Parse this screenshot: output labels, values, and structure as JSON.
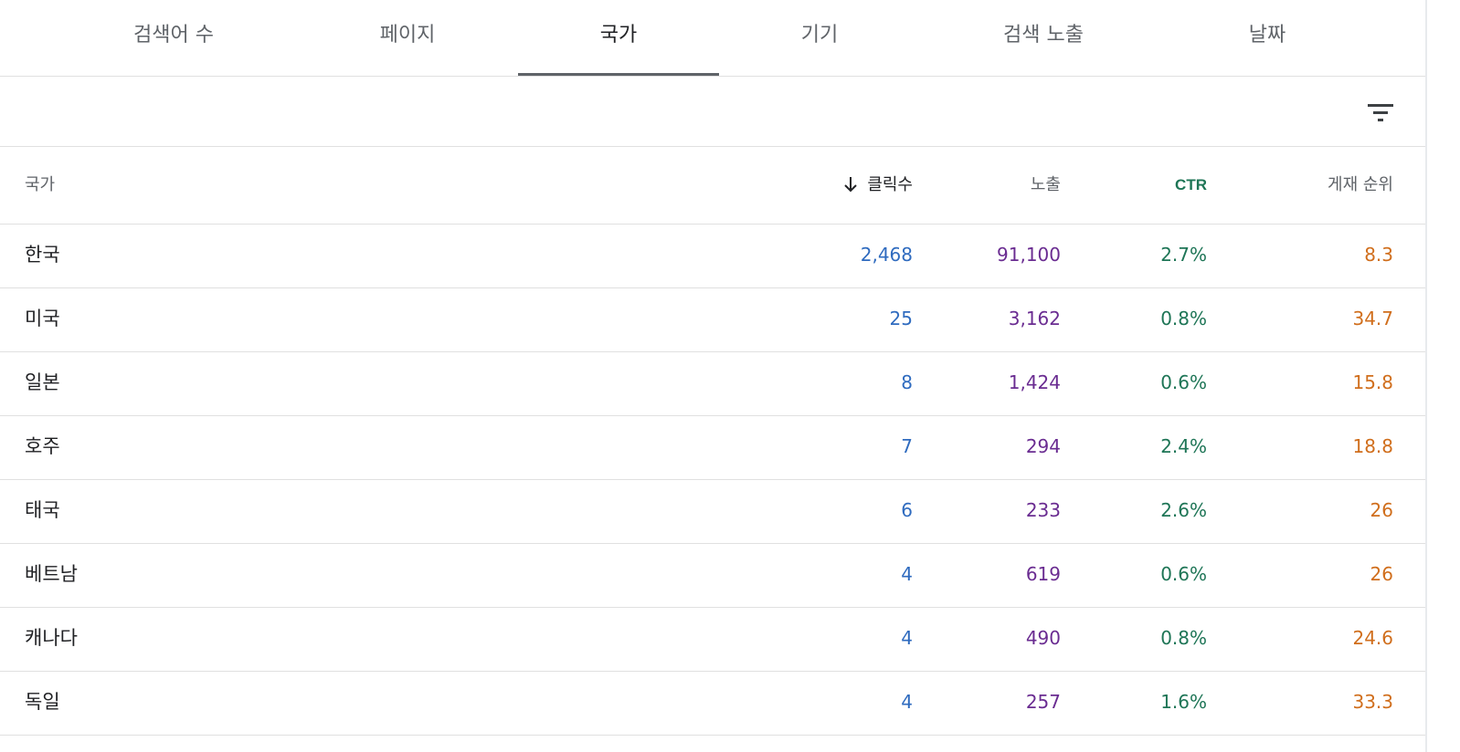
{
  "tabs": [
    {
      "label": "검색어 수",
      "active": false
    },
    {
      "label": "페이지",
      "active": false
    },
    {
      "label": "국가",
      "active": true
    },
    {
      "label": "기기",
      "active": false
    },
    {
      "label": "검색 노출",
      "active": false
    },
    {
      "label": "날짜",
      "active": false
    }
  ],
  "toolbar": {
    "filter_icon": "filter-list-icon"
  },
  "table": {
    "headers": {
      "country": "국가",
      "clicks": "클릭수",
      "impressions": "노출",
      "ctr": "CTR",
      "position": "게재 순위"
    },
    "sorted_by": "clicks",
    "sort_direction": "desc",
    "rows": [
      {
        "country": "한국",
        "clicks": "2,468",
        "impressions": "91,100",
        "ctr": "2.7%",
        "position": "8.3"
      },
      {
        "country": "미국",
        "clicks": "25",
        "impressions": "3,162",
        "ctr": "0.8%",
        "position": "34.7"
      },
      {
        "country": "일본",
        "clicks": "8",
        "impressions": "1,424",
        "ctr": "0.6%",
        "position": "15.8"
      },
      {
        "country": "호주",
        "clicks": "7",
        "impressions": "294",
        "ctr": "2.4%",
        "position": "18.8"
      },
      {
        "country": "태국",
        "clicks": "6",
        "impressions": "233",
        "ctr": "2.6%",
        "position": "26"
      },
      {
        "country": "베트남",
        "clicks": "4",
        "impressions": "619",
        "ctr": "0.6%",
        "position": "26"
      },
      {
        "country": "캐나다",
        "clicks": "4",
        "impressions": "490",
        "ctr": "0.8%",
        "position": "24.6"
      },
      {
        "country": "독일",
        "clicks": "4",
        "impressions": "257",
        "ctr": "1.6%",
        "position": "33.3"
      }
    ]
  },
  "colors": {
    "clicks": "#2f6bbf",
    "impressions": "#6a2c91",
    "ctr": "#1e7556",
    "position": "#d06e1c"
  }
}
